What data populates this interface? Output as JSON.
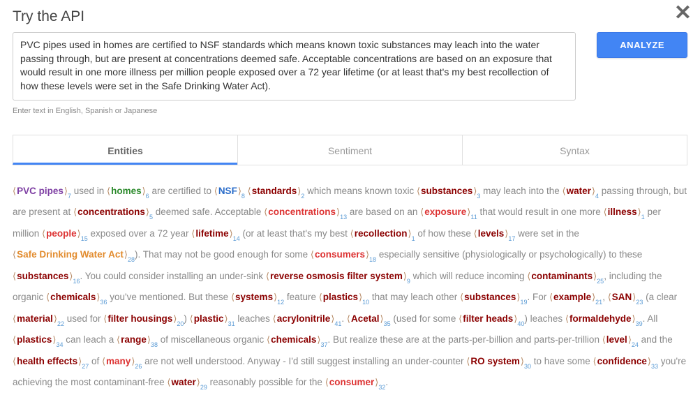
{
  "title": "Try the API",
  "close_glyph": "✕",
  "textarea_value": "PVC pipes used in homes are certified to NSF standards which means known toxic substances may leach into the water passing through, but are present at concentrations deemed safe. Acceptable concentrations are based on an exposure that would result in one more illness per million people exposed over a 72 year lifetime (or at least that's my best recollection of how these levels were set in the Safe Drinking Water Act).",
  "hint": "Enter text in English, Spanish or Japanese",
  "analyze_label": "ANALYZE",
  "tabs": {
    "entities": "Entities",
    "sentiment": "Sentiment",
    "syntax": "Syntax"
  },
  "tokens": [
    {
      "t": "ent",
      "text": "PVC pipes",
      "sub": "7",
      "cls": "c-purple"
    },
    {
      "t": "txt",
      "text": " used in "
    },
    {
      "t": "ent",
      "text": "homes",
      "sub": "6",
      "cls": "c-green"
    },
    {
      "t": "txt",
      "text": " are certified to "
    },
    {
      "t": "ent",
      "text": "NSF",
      "sub": "8",
      "cls": "c-blue"
    },
    {
      "t": "txt",
      "text": " "
    },
    {
      "t": "ent",
      "text": "standards",
      "sub": "2",
      "cls": "c-brown"
    },
    {
      "t": "txt",
      "text": " which means known toxic "
    },
    {
      "t": "ent",
      "text": "substances",
      "sub": "3",
      "cls": "c-brown"
    },
    {
      "t": "txt",
      "text": " may leach into the "
    },
    {
      "t": "ent",
      "text": "water",
      "sub": "4",
      "cls": "c-brown"
    },
    {
      "t": "txt",
      "text": " passing through, but are present at "
    },
    {
      "t": "ent",
      "text": "concentrations",
      "sub": "5",
      "cls": "c-brown"
    },
    {
      "t": "txt",
      "text": " deemed safe. Acceptable "
    },
    {
      "t": "ent",
      "text": "concentrations",
      "sub": "13",
      "cls": "c-red"
    },
    {
      "t": "txt",
      "text": " are based on an "
    },
    {
      "t": "ent",
      "text": "exposure",
      "sub": "11",
      "cls": "c-red"
    },
    {
      "t": "txt",
      "text": " that would result in one more "
    },
    {
      "t": "ent",
      "text": "illness",
      "sub": "1",
      "cls": "c-brown"
    },
    {
      "t": "txt",
      "text": " per million "
    },
    {
      "t": "ent",
      "text": "people",
      "sub": "15",
      "cls": "c-red"
    },
    {
      "t": "txt",
      "text": " exposed over a 72 year "
    },
    {
      "t": "ent",
      "text": "lifetime",
      "sub": "14",
      "cls": "c-brown"
    },
    {
      "t": "txt",
      "text": " (or at least that's my best "
    },
    {
      "t": "ent",
      "text": "recollection",
      "sub": "1",
      "cls": "c-brown"
    },
    {
      "t": "txt",
      "text": " of how these "
    },
    {
      "t": "ent",
      "text": "levels",
      "sub": "17",
      "cls": "c-brown"
    },
    {
      "t": "txt",
      "text": " were set in the "
    },
    {
      "t": "ent",
      "text": "Safe Drinking Water Act",
      "sub": "28",
      "cls": "c-orange"
    },
    {
      "t": "txt",
      "text": "). That may not be good enough for some "
    },
    {
      "t": "ent",
      "text": "consumers",
      "sub": "18",
      "cls": "c-red"
    },
    {
      "t": "txt",
      "text": " especially sensitive (physiologically or psychologically) to these "
    },
    {
      "t": "ent",
      "text": "substances",
      "sub": "16",
      "cls": "c-brown"
    },
    {
      "t": "txt",
      "text": ". You could consider installing an under-sink "
    },
    {
      "t": "ent",
      "text": "reverse osmosis filter system",
      "sub": "9",
      "cls": "c-brown"
    },
    {
      "t": "txt",
      "text": " which will reduce incoming "
    },
    {
      "t": "ent",
      "text": "contaminants",
      "sub": "25",
      "cls": "c-brown"
    },
    {
      "t": "txt",
      "text": ", including the organic "
    },
    {
      "t": "ent",
      "text": "chemicals",
      "sub": "36",
      "cls": "c-brown"
    },
    {
      "t": "txt",
      "text": " you've mentioned. But these "
    },
    {
      "t": "ent",
      "text": "systems",
      "sub": "12",
      "cls": "c-brown"
    },
    {
      "t": "txt",
      "text": " feature "
    },
    {
      "t": "ent",
      "text": "plastics",
      "sub": "10",
      "cls": "c-brown"
    },
    {
      "t": "txt",
      "text": " that may leach other "
    },
    {
      "t": "ent",
      "text": "substances",
      "sub": "19",
      "cls": "c-brown"
    },
    {
      "t": "txt",
      "text": ". For "
    },
    {
      "t": "ent",
      "text": "example",
      "sub": "21",
      "cls": "c-brown"
    },
    {
      "t": "txt",
      "text": ", "
    },
    {
      "t": "ent",
      "text": "SAN",
      "sub": "23",
      "cls": "c-brown"
    },
    {
      "t": "txt",
      "text": " (a clear "
    },
    {
      "t": "ent",
      "text": "material",
      "sub": "22",
      "cls": "c-brown"
    },
    {
      "t": "txt",
      "text": " used for "
    },
    {
      "t": "ent",
      "text": "filter housings",
      "sub": "20",
      "cls": "c-brown"
    },
    {
      "t": "txt",
      "text": ") "
    },
    {
      "t": "ent",
      "text": "plastic",
      "sub": "31",
      "cls": "c-brown"
    },
    {
      "t": "txt",
      "text": " leaches "
    },
    {
      "t": "ent",
      "text": "acrylonitrile",
      "sub": "41",
      "cls": "c-brown"
    },
    {
      "t": "txt",
      "text": ". "
    },
    {
      "t": "ent",
      "text": "Acetal",
      "sub": "35",
      "cls": "c-brown"
    },
    {
      "t": "txt",
      "text": " (used for some "
    },
    {
      "t": "ent",
      "text": "filter heads",
      "sub": "40",
      "cls": "c-brown"
    },
    {
      "t": "txt",
      "text": ") leaches "
    },
    {
      "t": "ent",
      "text": "formaldehyde",
      "sub": "39",
      "cls": "c-brown"
    },
    {
      "t": "txt",
      "text": ". All "
    },
    {
      "t": "ent",
      "text": "plastics",
      "sub": "34",
      "cls": "c-brown"
    },
    {
      "t": "txt",
      "text": " can leach a "
    },
    {
      "t": "ent",
      "text": "range",
      "sub": "38",
      "cls": "c-brown"
    },
    {
      "t": "txt",
      "text": " of miscellaneous organic "
    },
    {
      "t": "ent",
      "text": "chemicals",
      "sub": "37",
      "cls": "c-brown"
    },
    {
      "t": "txt",
      "text": ". But realize these are at the parts-per-billion and parts-per-trillion "
    },
    {
      "t": "ent",
      "text": "level",
      "sub": "24",
      "cls": "c-brown"
    },
    {
      "t": "txt",
      "text": " and the "
    },
    {
      "t": "ent",
      "text": "health effects",
      "sub": "27",
      "cls": "c-brown"
    },
    {
      "t": "txt",
      "text": " of "
    },
    {
      "t": "ent",
      "text": "many",
      "sub": "26",
      "cls": "c-red"
    },
    {
      "t": "txt",
      "text": " are not well understood. Anyway - I'd still suggest installing an under-counter "
    },
    {
      "t": "ent",
      "text": "RO system",
      "sub": "30",
      "cls": "c-brown"
    },
    {
      "t": "txt",
      "text": " to have some "
    },
    {
      "t": "ent",
      "text": "confidence",
      "sub": "33",
      "cls": "c-brown"
    },
    {
      "t": "txt",
      "text": " you're achieving the most contaminant-free "
    },
    {
      "t": "ent",
      "text": "water",
      "sub": "29",
      "cls": "c-brown"
    },
    {
      "t": "txt",
      "text": " reasonably possible for the "
    },
    {
      "t": "ent",
      "text": "consumer",
      "sub": "32",
      "cls": "c-red"
    },
    {
      "t": "txt",
      "text": "."
    }
  ]
}
